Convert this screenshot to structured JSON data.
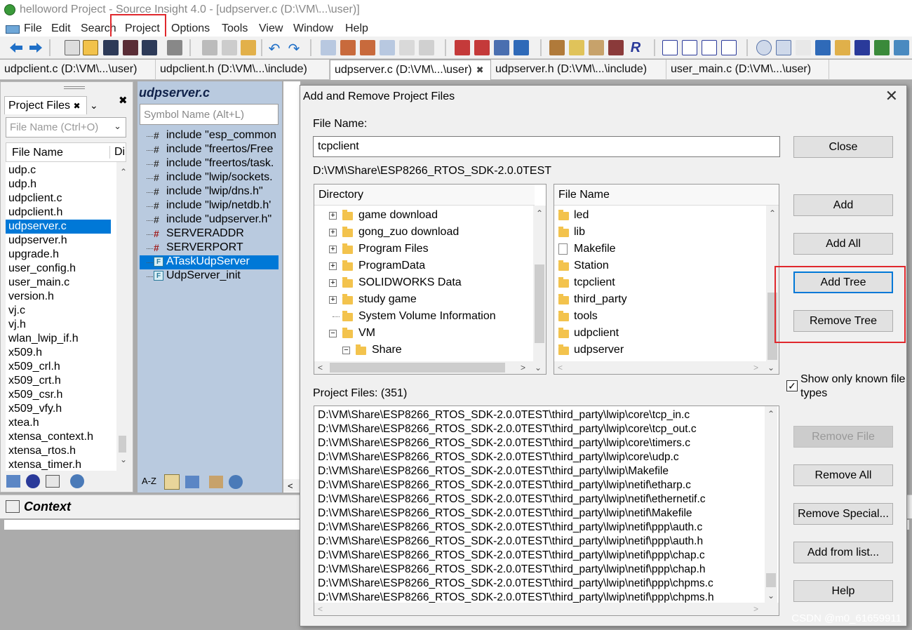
{
  "window": {
    "title": "helloword Project - Source Insight 4.0 - [udpserver.c (D:\\VM\\...\\user)]"
  },
  "menu": [
    "File",
    "Edit",
    "Search",
    "Project",
    "Options",
    "Tools",
    "View",
    "Window",
    "Help"
  ],
  "tabs": [
    {
      "label": "udpclient.c (D:\\VM\\...\\user)",
      "active": false
    },
    {
      "label": "udpclient.h (D:\\VM\\...\\include)",
      "active": false
    },
    {
      "label": "udpserver.c (D:\\VM\\...\\user)",
      "active": true
    },
    {
      "label": "udpserver.h (D:\\VM\\...\\include)",
      "active": false
    },
    {
      "label": "user_main.c (D:\\VM\\...\\user)",
      "active": false
    }
  ],
  "project_files_panel": {
    "tab_label": "Project Files",
    "search_placeholder": "File Name (Ctrl+O)",
    "column_name": "File Name",
    "column_dir": "Di",
    "items": [
      "udp.c",
      "udp.h",
      "udpclient.c",
      "udpclient.h",
      "udpserver.c",
      "udpserver.h",
      "upgrade.h",
      "user_config.h",
      "user_main.c",
      "version.h",
      "vj.c",
      "vj.h",
      "wlan_lwip_if.h",
      "x509.h",
      "x509_crl.h",
      "x509_crt.h",
      "x509_csr.h",
      "x509_vfy.h",
      "xtea.h",
      "xtensa_context.h",
      "xtensa_rtos.h",
      "xtensa_timer.h"
    ],
    "selected": "udpserver.c"
  },
  "symbol_panel": {
    "title": "udpserver.c",
    "search_placeholder": "Symbol Name (Alt+L)",
    "items": [
      {
        "label": "include \"esp_common",
        "kind": "include"
      },
      {
        "label": "include \"freertos/Free",
        "kind": "include"
      },
      {
        "label": "include \"freertos/task.",
        "kind": "include"
      },
      {
        "label": "include \"lwip/sockets.",
        "kind": "include"
      },
      {
        "label": "include \"lwip/dns.h\"",
        "kind": "include"
      },
      {
        "label": "include \"lwip/netdb.h'",
        "kind": "include"
      },
      {
        "label": "include \"udpserver.h\"",
        "kind": "include"
      },
      {
        "label": "SERVERADDR",
        "kind": "define"
      },
      {
        "label": "SERVERPORT",
        "kind": "define"
      },
      {
        "label": "ATaskUdpServer",
        "kind": "function"
      },
      {
        "label": "UdpServer_init",
        "kind": "function"
      }
    ],
    "selected": "ATaskUdpServer"
  },
  "context_panel": {
    "title": "Context"
  },
  "dialog": {
    "title": "Add and Remove Project Files",
    "file_name_label": "File Name:",
    "file_name_value": "tcpclient",
    "current_path": "D:\\VM\\Share\\ESP8266_RTOS_SDK-2.0.0TEST",
    "directory_header": "Directory",
    "directories": [
      {
        "label": "game download",
        "expander": "+",
        "level": 1
      },
      {
        "label": "gong_zuo download",
        "expander": "+",
        "level": 1
      },
      {
        "label": "Program Files",
        "expander": "+",
        "level": 1
      },
      {
        "label": "ProgramData",
        "expander": "+",
        "level": 1
      },
      {
        "label": "SOLIDWORKS Data",
        "expander": "+",
        "level": 1
      },
      {
        "label": "study game",
        "expander": "+",
        "level": 1
      },
      {
        "label": "System Volume Information",
        "expander": "",
        "level": 1
      },
      {
        "label": "VM",
        "expander": "-",
        "level": 1
      },
      {
        "label": "Share",
        "expander": "-",
        "level": 2
      }
    ],
    "filename_header": "File Name",
    "files": [
      {
        "label": "led",
        "type": "folder"
      },
      {
        "label": "lib",
        "type": "folder"
      },
      {
        "label": "Makefile",
        "type": "file"
      },
      {
        "label": "Station",
        "type": "folder"
      },
      {
        "label": "tcpclient",
        "type": "folder"
      },
      {
        "label": "third_party",
        "type": "folder"
      },
      {
        "label": "tools",
        "type": "folder"
      },
      {
        "label": "udpclient",
        "type": "folder"
      },
      {
        "label": "udpserver",
        "type": "folder"
      }
    ],
    "show_known_label": "Show only known file types",
    "show_known_checked": true,
    "project_files_label": "Project Files: (351)",
    "project_files": [
      "D:\\VM\\Share\\ESP8266_RTOS_SDK-2.0.0TEST\\third_party\\lwip\\core\\tcp_in.c",
      "D:\\VM\\Share\\ESP8266_RTOS_SDK-2.0.0TEST\\third_party\\lwip\\core\\tcp_out.c",
      "D:\\VM\\Share\\ESP8266_RTOS_SDK-2.0.0TEST\\third_party\\lwip\\core\\timers.c",
      "D:\\VM\\Share\\ESP8266_RTOS_SDK-2.0.0TEST\\third_party\\lwip\\core\\udp.c",
      "D:\\VM\\Share\\ESP8266_RTOS_SDK-2.0.0TEST\\third_party\\lwip\\Makefile",
      "D:\\VM\\Share\\ESP8266_RTOS_SDK-2.0.0TEST\\third_party\\lwip\\netif\\etharp.c",
      "D:\\VM\\Share\\ESP8266_RTOS_SDK-2.0.0TEST\\third_party\\lwip\\netif\\ethernetif.c",
      "D:\\VM\\Share\\ESP8266_RTOS_SDK-2.0.0TEST\\third_party\\lwip\\netif\\Makefile",
      "D:\\VM\\Share\\ESP8266_RTOS_SDK-2.0.0TEST\\third_party\\lwip\\netif\\ppp\\auth.c",
      "D:\\VM\\Share\\ESP8266_RTOS_SDK-2.0.0TEST\\third_party\\lwip\\netif\\ppp\\auth.h",
      "D:\\VM\\Share\\ESP8266_RTOS_SDK-2.0.0TEST\\third_party\\lwip\\netif\\ppp\\chap.c",
      "D:\\VM\\Share\\ESP8266_RTOS_SDK-2.0.0TEST\\third_party\\lwip\\netif\\ppp\\chap.h",
      "D:\\VM\\Share\\ESP8266_RTOS_SDK-2.0.0TEST\\third_party\\lwip\\netif\\ppp\\chpms.c",
      "D:\\VM\\Share\\ESP8266_RTOS_SDK-2.0.0TEST\\third_party\\lwip\\netif\\ppp\\chpms.h"
    ],
    "buttons": {
      "close": "Close",
      "add": "Add",
      "add_all": "Add All",
      "add_tree": "Add Tree",
      "remove_tree": "Remove Tree",
      "remove_file": "Remove File",
      "remove_all": "Remove All",
      "remove_special": "Remove Special...",
      "add_from_list": "Add from list...",
      "help": "Help"
    }
  },
  "watermark": "CSDN @m0_61659911",
  "colors": {
    "highlight": "#e0282d",
    "selection": "#0078d7",
    "folder": "#f3c34d",
    "symbol_panel_bg": "#b9cadf"
  }
}
